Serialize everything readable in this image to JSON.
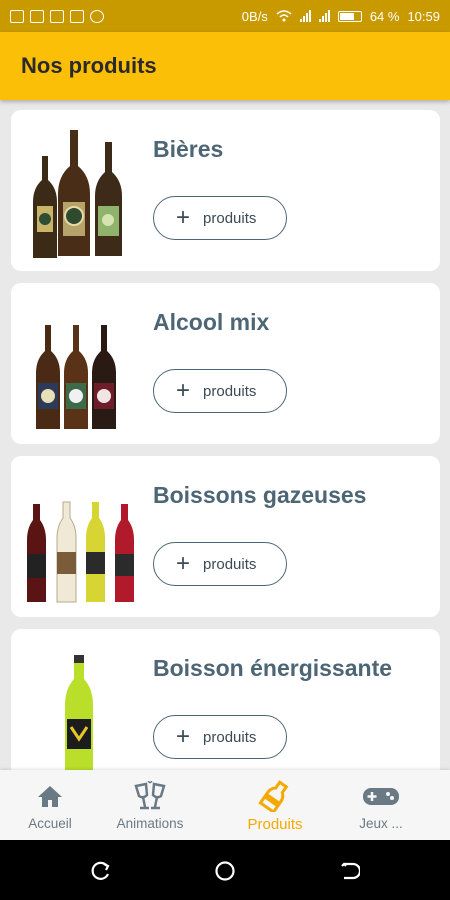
{
  "status_bar": {
    "network_speed": "0B/s",
    "battery": "64 %",
    "time": "10:59"
  },
  "app_bar": {
    "title": "Nos produits"
  },
  "products": [
    {
      "title": "Bières",
      "button_label": "produits",
      "image": "beer-bottles"
    },
    {
      "title": "Alcool mix",
      "button_label": "produits",
      "image": "mix-bottles"
    },
    {
      "title": "Boissons gazeuses",
      "button_label": "produits",
      "image": "soda-bottles"
    },
    {
      "title": "Boisson énergissante",
      "button_label": "produits",
      "image": "energy-bottle"
    }
  ],
  "bottom_nav": [
    {
      "label": "Accueil",
      "icon": "home-icon",
      "active": false
    },
    {
      "label": "Animations",
      "icon": "cheers-icon",
      "active": false
    },
    {
      "label": "Produits",
      "icon": "bottle-icon",
      "active": true
    },
    {
      "label": "Jeux ...",
      "icon": "gamepad-icon",
      "active": false
    }
  ],
  "colors": {
    "primary": "#fcbf07",
    "status_bar": "#c99a00",
    "active_nav": "#f5a800",
    "title_text": "#4d6675"
  }
}
